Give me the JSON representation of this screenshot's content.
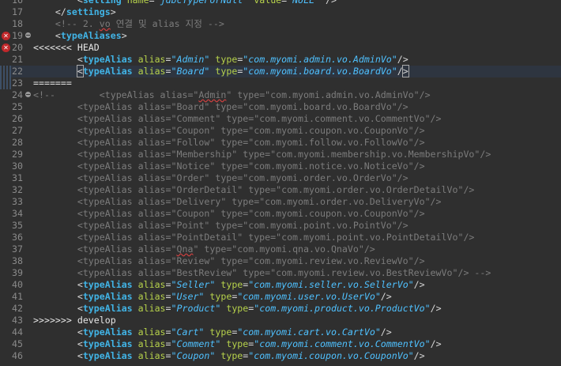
{
  "editor": {
    "colors": {
      "background": "#2f2f2f",
      "tag": "#41b4e6",
      "attribute": "#b6d14b",
      "value": "#4fc1ff",
      "comment": "#7c7c7c",
      "line_number": "#8a8a8a",
      "error": "#c0282b"
    },
    "icons": {
      "error": "error-icon",
      "fold": "fold-collapse-icon",
      "change": "change-marker-icon"
    },
    "lines": [
      {
        "n": "16",
        "tokens": [
          {
            "t": "        "
          },
          {
            "t": "<",
            "c": "pun"
          },
          {
            "t": "setting",
            "c": "tag"
          },
          {
            "t": " "
          },
          {
            "t": "name",
            "c": "attr"
          },
          {
            "t": "=",
            "c": "pun"
          },
          {
            "t": "\"jdbcTypeForNull\"",
            "c": "val"
          },
          {
            "t": " "
          },
          {
            "t": "value",
            "c": "attr"
          },
          {
            "t": "=",
            "c": "pun"
          },
          {
            "t": "\"NULL\"",
            "c": "val"
          },
          {
            "t": " />",
            "c": "pun"
          }
        ]
      },
      {
        "n": "17",
        "tokens": [
          {
            "t": "    "
          },
          {
            "t": "</",
            "c": "pun"
          },
          {
            "t": "settings",
            "c": "tag"
          },
          {
            "t": ">",
            "c": "pun"
          }
        ]
      },
      {
        "n": "18",
        "tokens": [
          {
            "t": "    "
          },
          {
            "t": "<!-- 2. ",
            "c": "cmt"
          },
          {
            "t": "vo",
            "c": "cmt",
            "warn": true
          },
          {
            "t": " 연결 및 alias 지정 -->",
            "c": "cmt"
          }
        ]
      },
      {
        "n": "19",
        "error": true,
        "fold": true,
        "tokens": [
          {
            "t": "    "
          },
          {
            "t": "<",
            "c": "pun"
          },
          {
            "t": "typeAliases",
            "c": "tag"
          },
          {
            "t": ">",
            "c": "pun"
          }
        ]
      },
      {
        "n": "20",
        "error": true,
        "tokens": [
          {
            "t": "<<<<<<< HEAD",
            "c": "plain"
          }
        ]
      },
      {
        "n": "21",
        "tokens": [
          {
            "t": "        "
          },
          {
            "t": "<",
            "c": "pun"
          },
          {
            "t": "typeAlias",
            "c": "tag"
          },
          {
            "t": " "
          },
          {
            "t": "alias",
            "c": "attr"
          },
          {
            "t": "=",
            "c": "pun"
          },
          {
            "t": "\"Admin\"",
            "c": "val"
          },
          {
            "t": " "
          },
          {
            "t": "type",
            "c": "attr"
          },
          {
            "t": "=",
            "c": "pun"
          },
          {
            "t": "\"com.myomi.admin.vo.AdminVo\"",
            "c": "val"
          },
          {
            "t": "/>",
            "c": "pun"
          }
        ]
      },
      {
        "n": "22",
        "highlight": true,
        "change": true,
        "tokens": [
          {
            "t": "        "
          },
          {
            "t": "<",
            "c": "pun",
            "bracket": true
          },
          {
            "t": "typeAlias",
            "c": "tag"
          },
          {
            "t": " "
          },
          {
            "t": "alias",
            "c": "attr"
          },
          {
            "t": "=",
            "c": "pun"
          },
          {
            "t": "\"Board\"",
            "c": "val"
          },
          {
            "t": " "
          },
          {
            "t": "type",
            "c": "attr"
          },
          {
            "t": "=",
            "c": "pun"
          },
          {
            "t": "\"com.myomi.board.vo.BoardVo\"",
            "c": "val"
          },
          {
            "t": "/",
            "c": "pun"
          },
          {
            "t": ">",
            "c": "pun",
            "bracket": true
          },
          {
            "caret": true
          }
        ]
      },
      {
        "n": "23",
        "change": true,
        "tokens": [
          {
            "t": "=======",
            "c": "plain"
          }
        ]
      },
      {
        "n": "24",
        "fold": true,
        "tokens": [
          {
            "t": "<!--        <typeAlias alias=\"",
            "c": "cmt"
          },
          {
            "t": "Admin",
            "c": "cmt",
            "warn": true
          },
          {
            "t": "\" type=\"com.myomi.admin.vo.AdminVo\"/>",
            "c": "cmt"
          }
        ]
      },
      {
        "n": "25",
        "tokens": [
          {
            "t": "        <typeAlias alias=\"Board\" type=\"com.myomi.board.vo.BoardVo\"/>",
            "c": "cmt"
          }
        ]
      },
      {
        "n": "26",
        "tokens": [
          {
            "t": "        <typeAlias alias=\"Comment\" type=\"com.myomi.comment.vo.CommentVo\"/>",
            "c": "cmt"
          }
        ]
      },
      {
        "n": "27",
        "tokens": [
          {
            "t": "        <typeAlias alias=\"Coupon\" type=\"com.myomi.coupon.vo.CouponVo\"/>",
            "c": "cmt"
          }
        ]
      },
      {
        "n": "28",
        "tokens": [
          {
            "t": "        <typeAlias alias=\"Follow\" type=\"com.myomi.follow.vo.FollowVo\"/>",
            "c": "cmt"
          }
        ]
      },
      {
        "n": "29",
        "tokens": [
          {
            "t": "        <typeAlias alias=\"Membership\" type=\"com.myomi.membership.vo.MembershipVo\"/>",
            "c": "cmt"
          }
        ]
      },
      {
        "n": "30",
        "tokens": [
          {
            "t": "        <typeAlias alias=\"Notice\" type=\"com.myomi.notice.vo.NoticeVo\"/>",
            "c": "cmt"
          }
        ]
      },
      {
        "n": "31",
        "tokens": [
          {
            "t": "        <typeAlias alias=\"Order\" type=\"com.myomi.order.vo.OrderVo\"/>",
            "c": "cmt"
          }
        ]
      },
      {
        "n": "32",
        "tokens": [
          {
            "t": "        <typeAlias alias=\"OrderDetail\" type=\"com.myomi.order.vo.OrderDetailVo\"/>",
            "c": "cmt"
          }
        ]
      },
      {
        "n": "33",
        "tokens": [
          {
            "t": "        <typeAlias alias=\"Delivery\" type=\"com.myomi.order.vo.DeliveryVo\"/>",
            "c": "cmt"
          }
        ]
      },
      {
        "n": "34",
        "tokens": [
          {
            "t": "        <typeAlias alias=\"Coupon\" type=\"com.myomi.coupon.vo.CouponVo\"/>",
            "c": "cmt"
          }
        ]
      },
      {
        "n": "35",
        "tokens": [
          {
            "t": "        <typeAlias alias=\"Point\" type=\"com.myomi.point.vo.PointVo\"/>",
            "c": "cmt"
          }
        ]
      },
      {
        "n": "36",
        "tokens": [
          {
            "t": "        <typeAlias alias=\"PointDetail\" type=\"com.myomi.point.vo.PointDetailVo\"/>",
            "c": "cmt"
          }
        ]
      },
      {
        "n": "37",
        "tokens": [
          {
            "t": "        <typeAlias alias=\"",
            "c": "cmt"
          },
          {
            "t": "Qna",
            "c": "cmt",
            "warn": true
          },
          {
            "t": "\" type=\"com.myomi.qna.vo.QnaVo\"/>",
            "c": "cmt"
          }
        ]
      },
      {
        "n": "38",
        "tokens": [
          {
            "t": "        <typeAlias alias=\"Review\" type=\"com.myomi.review.vo.ReviewVo\"/>",
            "c": "cmt"
          }
        ]
      },
      {
        "n": "39",
        "tokens": [
          {
            "t": "        <typeAlias alias=\"BestReview\" type=\"com.myomi.review.vo.BestReviewVo\"/> -->",
            "c": "cmt"
          }
        ]
      },
      {
        "n": "40",
        "tokens": [
          {
            "t": "        "
          },
          {
            "t": "<",
            "c": "pun"
          },
          {
            "t": "typeAlias",
            "c": "tag"
          },
          {
            "t": " "
          },
          {
            "t": "alias",
            "c": "attr"
          },
          {
            "t": "=",
            "c": "pun"
          },
          {
            "t": "\"Seller\"",
            "c": "val"
          },
          {
            "t": " "
          },
          {
            "t": "type",
            "c": "attr"
          },
          {
            "t": "=",
            "c": "pun"
          },
          {
            "t": "\"com.myomi.seller.vo.SellerVo\"",
            "c": "val"
          },
          {
            "t": "/>",
            "c": "pun"
          }
        ]
      },
      {
        "n": "41",
        "tokens": [
          {
            "t": "        "
          },
          {
            "t": "<",
            "c": "pun"
          },
          {
            "t": "typeAlias",
            "c": "tag"
          },
          {
            "t": " "
          },
          {
            "t": "alias",
            "c": "attr"
          },
          {
            "t": "=",
            "c": "pun"
          },
          {
            "t": "\"User\"",
            "c": "val"
          },
          {
            "t": " "
          },
          {
            "t": "type",
            "c": "attr"
          },
          {
            "t": "=",
            "c": "pun"
          },
          {
            "t": "\"com.myomi.user.vo.UserVo\"",
            "c": "val"
          },
          {
            "t": "/>",
            "c": "pun"
          }
        ]
      },
      {
        "n": "42",
        "tokens": [
          {
            "t": "        "
          },
          {
            "t": "<",
            "c": "pun"
          },
          {
            "t": "typeAlias",
            "c": "tag"
          },
          {
            "t": " "
          },
          {
            "t": "alias",
            "c": "attr"
          },
          {
            "t": "=",
            "c": "pun"
          },
          {
            "t": "\"Product\"",
            "c": "val"
          },
          {
            "t": " "
          },
          {
            "t": "type",
            "c": "attr"
          },
          {
            "t": "=",
            "c": "pun"
          },
          {
            "t": "\"com.myomi.product.vo.ProductVo\"",
            "c": "val"
          },
          {
            "t": "/>",
            "c": "pun"
          }
        ]
      },
      {
        "n": "43",
        "tokens": [
          {
            "t": ">>>>>>> develop",
            "c": "plain"
          }
        ]
      },
      {
        "n": "44",
        "tokens": [
          {
            "t": "        "
          },
          {
            "t": "<",
            "c": "pun"
          },
          {
            "t": "typeAlias",
            "c": "tag"
          },
          {
            "t": " "
          },
          {
            "t": "alias",
            "c": "attr"
          },
          {
            "t": "=",
            "c": "pun"
          },
          {
            "t": "\"Cart\"",
            "c": "val"
          },
          {
            "t": " "
          },
          {
            "t": "type",
            "c": "attr"
          },
          {
            "t": "=",
            "c": "pun"
          },
          {
            "t": "\"com.myomi.cart.vo.CartVo\"",
            "c": "val"
          },
          {
            "t": "/>",
            "c": "pun"
          }
        ]
      },
      {
        "n": "45",
        "tokens": [
          {
            "t": "        "
          },
          {
            "t": "<",
            "c": "pun"
          },
          {
            "t": "typeAlias",
            "c": "tag"
          },
          {
            "t": " "
          },
          {
            "t": "alias",
            "c": "attr"
          },
          {
            "t": "=",
            "c": "pun"
          },
          {
            "t": "\"Comment\"",
            "c": "val"
          },
          {
            "t": " "
          },
          {
            "t": "type",
            "c": "attr"
          },
          {
            "t": "=",
            "c": "pun"
          },
          {
            "t": "\"com.myomi.comment.vo.CommentVo\"",
            "c": "val"
          },
          {
            "t": "/>",
            "c": "pun"
          }
        ]
      },
      {
        "n": "46",
        "tokens": [
          {
            "t": "        "
          },
          {
            "t": "<",
            "c": "pun"
          },
          {
            "t": "typeAlias",
            "c": "tag"
          },
          {
            "t": " "
          },
          {
            "t": "alias",
            "c": "attr"
          },
          {
            "t": "=",
            "c": "pun"
          },
          {
            "t": "\"Coupon\"",
            "c": "val"
          },
          {
            "t": " "
          },
          {
            "t": "type",
            "c": "attr"
          },
          {
            "t": "=",
            "c": "pun"
          },
          {
            "t": "\"com.myomi.coupon.vo.CouponVo\"",
            "c": "val"
          },
          {
            "t": "/>",
            "c": "pun"
          }
        ]
      }
    ]
  }
}
